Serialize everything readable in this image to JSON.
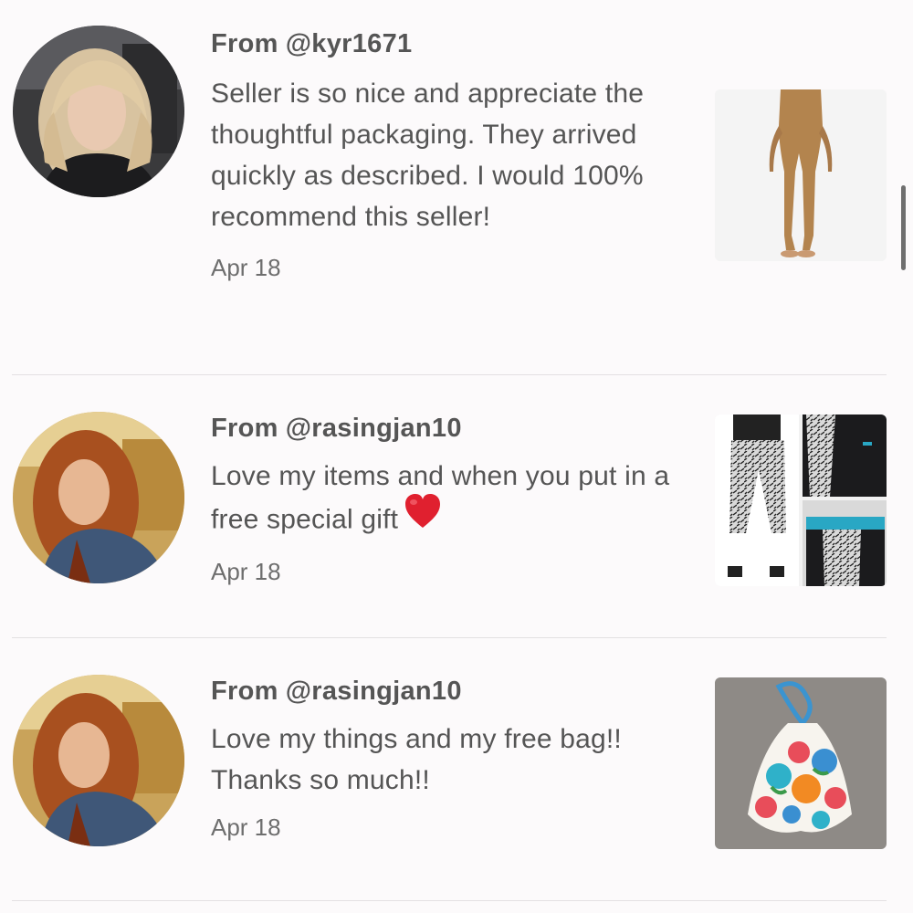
{
  "reviews": [
    {
      "from_prefix": "From",
      "handle": "@kyr1671",
      "message": "Seller is so nice and appreciate the thoughtful packaging. They arrived quickly as described. I would 100% recommend this seller!",
      "date": "Apr 18",
      "avatar_icon": "user-photo",
      "thumbnail": "tan-leggings-photo"
    },
    {
      "from_prefix": "From",
      "handle": "@rasingjan10",
      "message": "Love my items and when you put in a free special gift",
      "emoji": "red-heart-icon",
      "date": "Apr 18",
      "avatar_icon": "user-photo",
      "thumbnail": "patterned-leggings-collage"
    },
    {
      "from_prefix": "From",
      "handle": "@rasingjan10",
      "message": "Love my things and my free bag!! Thanks so much!!",
      "date": "Apr 18",
      "avatar_icon": "user-photo",
      "thumbnail": "floral-halter-top-photo"
    }
  ],
  "colors": {
    "background": "#fcfafb",
    "text": "#555555",
    "divider": "#e3e0e2",
    "heart": "#e0202f"
  }
}
